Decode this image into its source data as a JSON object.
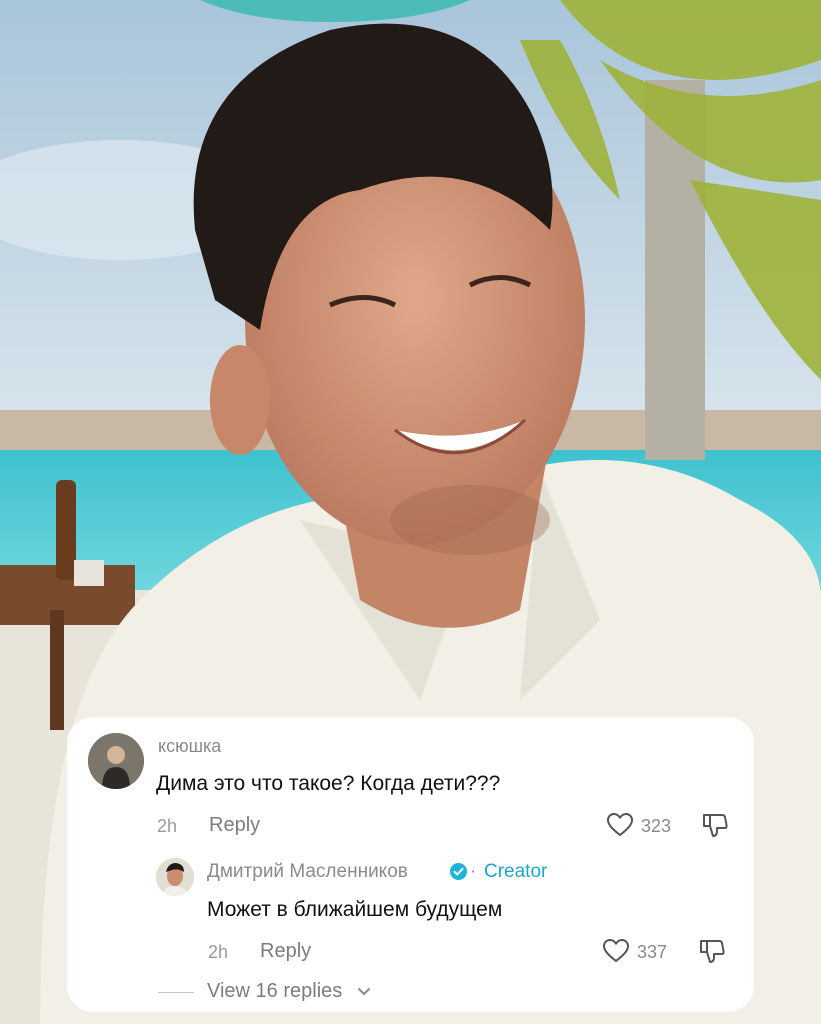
{
  "comment": {
    "username": "ксюшка",
    "text": "Дима это что такое? Когда дети???",
    "time": "2h",
    "reply_label": "Reply",
    "likes": "323"
  },
  "reply": {
    "username": "Дмитрий Масленников",
    "separator": "·",
    "creator_label": "Creator",
    "text": "Может в ближайшем будущем",
    "time": "2h",
    "reply_label": "Reply",
    "likes": "337"
  },
  "view_replies_label": "View 16 replies",
  "colors": {
    "creator": "#1ea7c8",
    "verified": "#20b3d8",
    "card": "#ffffff",
    "secondary_text": "#8a8a8a"
  },
  "icons": [
    "verified-badge-icon",
    "heart-icon",
    "dislike-icon",
    "chevron-down-icon"
  ]
}
